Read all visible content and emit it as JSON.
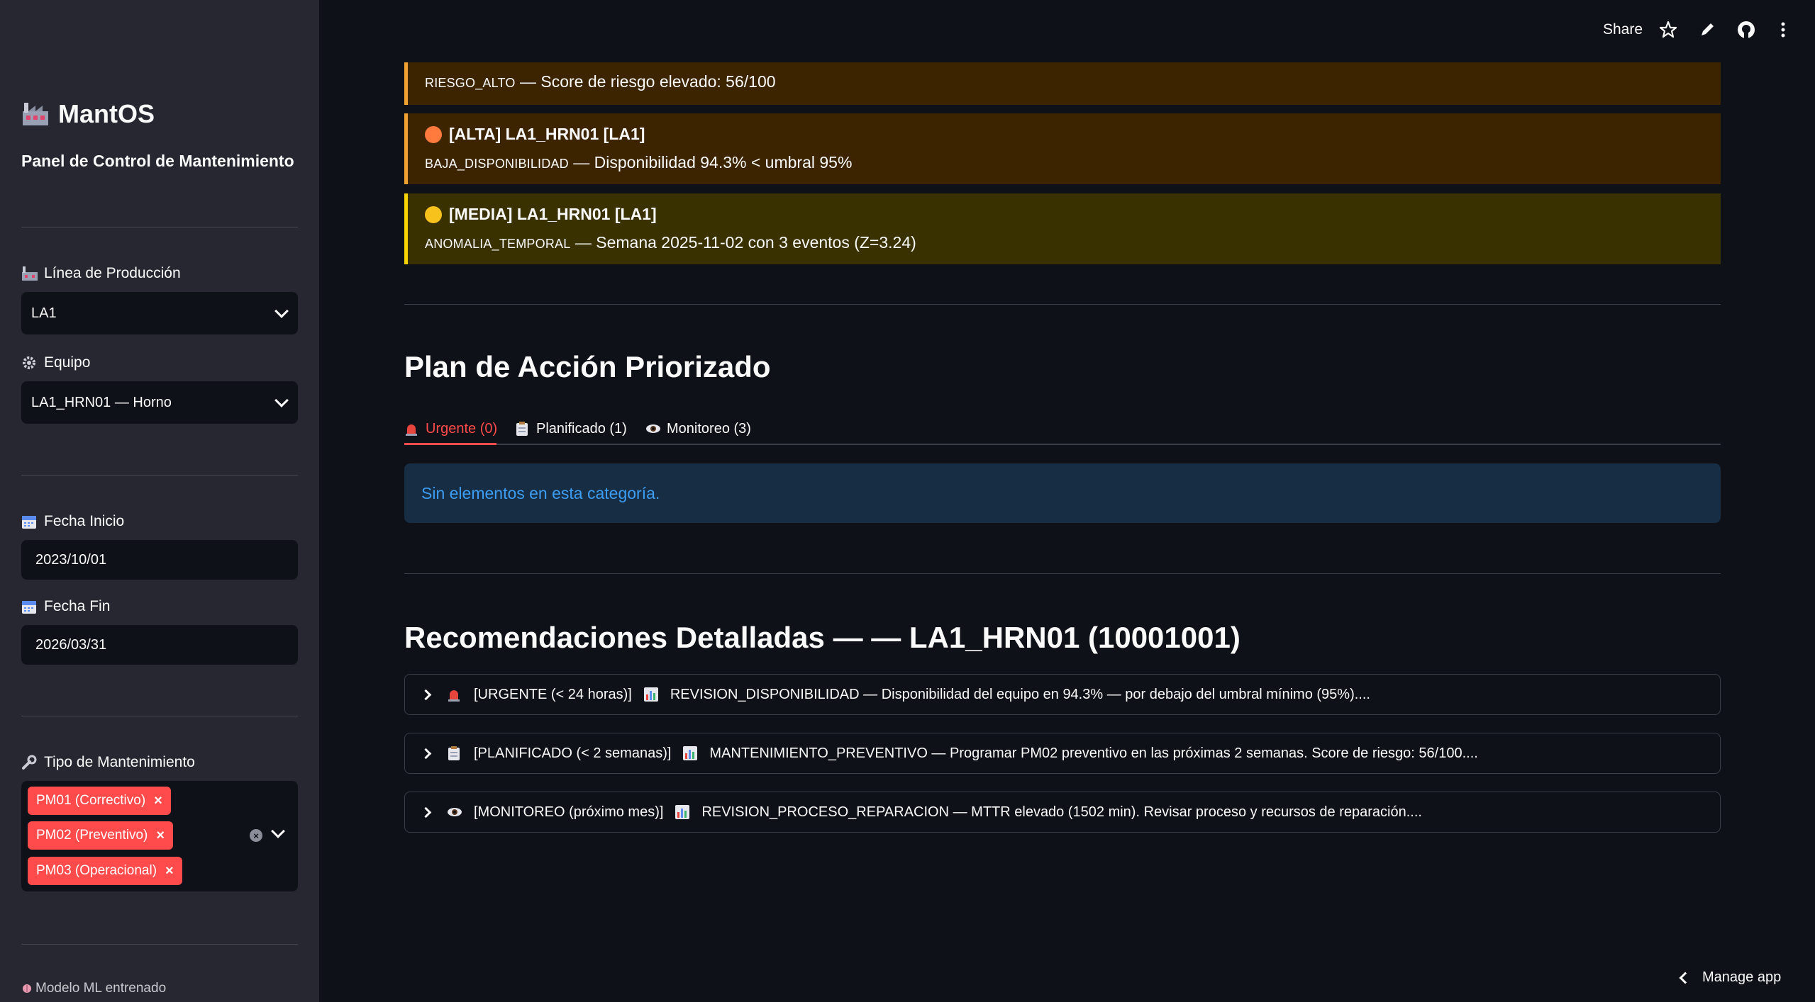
{
  "sidebar": {
    "brand_title": "MantOS",
    "brand_subtitle": "Panel de Control de Mantenimiento",
    "line_label": "Línea de Producción",
    "line_value": "LA1",
    "equipment_label": "Equipo",
    "equipment_value": "LA1_HRN01 — Horno",
    "start_label": "Fecha Inicio",
    "start_value": "2023/10/01",
    "end_label": "Fecha Fin",
    "end_value": "2026/03/31",
    "type_label": "Tipo de Mantenimiento",
    "type_tags": [
      "PM01 (Correctivo)",
      "PM02 (Preventivo)",
      "PM03 (Operacional)"
    ],
    "model_status": "Modelo ML entrenado"
  },
  "header": {
    "share_label": "Share"
  },
  "alerts": [
    {
      "title": "",
      "code": "RIESGO_ALTO",
      "text": " — Score de riesgo elevado: 56/100",
      "dot_color": "#e8523c",
      "bg": "#3d2400",
      "border": "#f0a330"
    },
    {
      "title": "[ALTA] LA1_HRN01 [LA1]",
      "code": "BAJA_DISPONIBILIDAD",
      "text": " — Disponibilidad 94.3% < umbral 95%",
      "dot_color": "#ff7a3c",
      "bg": "#3d2400",
      "border": "#f0a330"
    },
    {
      "title": "[MEDIA] LA1_HRN01 [LA1]",
      "code": "ANOMALIA_TEMPORAL",
      "text": " — Semana 2025-11-02 con 3 eventos (Z=3.24)",
      "dot_color": "#f7c21c",
      "bg": "#3a3100",
      "border": "#f7d400"
    }
  ],
  "action_plan": {
    "heading": "Plan de Acción Priorizado",
    "tabs": [
      {
        "label": "Urgente (0)",
        "icon": "siren-icon"
      },
      {
        "label": "Planificado (1)",
        "icon": "clipboard-icon"
      },
      {
        "label": "Monitoreo (3)",
        "icon": "eye-icon"
      }
    ],
    "empty_message": "Sin elementos en esta categoría."
  },
  "recommendations": {
    "heading": "Recomendaciones Detalladas — — LA1_HRN01 (10001001)",
    "items": [
      {
        "icon": "siren-icon",
        "text": "[URGENTE (< 24 horas)]",
        "chart_icon": "bar-chart-icon",
        "detail": "REVISION_DISPONIBILIDAD — Disponibilidad del equipo en 94.3% — por debajo del umbral mínimo (95%)...."
      },
      {
        "icon": "clipboard-icon",
        "text": "[PLANIFICADO (< 2 semanas)]",
        "chart_icon": "bar-chart-icon",
        "detail": "MANTENIMIENTO_PREVENTIVO — Programar PM02 preventivo en las próximas 2 semanas. Score de riesgo: 56/100...."
      },
      {
        "icon": "eye-icon",
        "text": "[MONITOREO (próximo mes)]",
        "chart_icon": "bar-chart-icon",
        "detail": "REVISION_PROCESO_REPARACION — MTTR elevado (1502 min). Revisar proceso y recursos de reparación...."
      }
    ]
  },
  "footer": {
    "manage_label": "Manage app"
  },
  "colors": {
    "accent": "#ff4b4b",
    "sidebar_bg": "#262730",
    "main_bg": "#0e1117",
    "info_bg": "#172d43",
    "info_text": "#3d9df3"
  }
}
